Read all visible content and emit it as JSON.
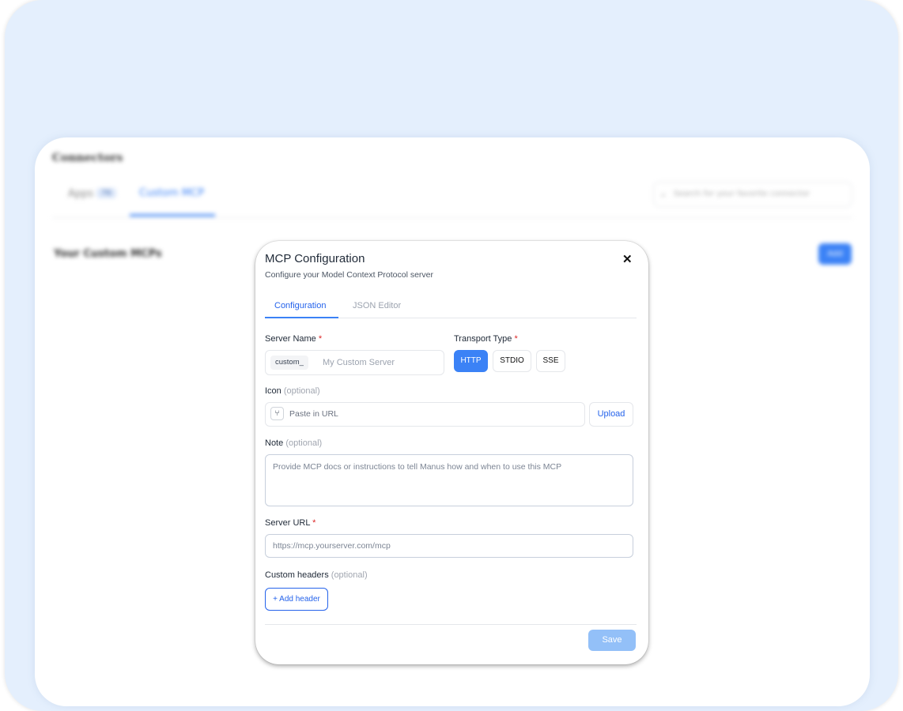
{
  "background": {
    "title": "Connectors",
    "tabs": [
      {
        "label": "Apps",
        "count": "76"
      },
      {
        "label": "Custom MCP"
      }
    ],
    "search_placeholder": "Search for your favorite connector",
    "section_title": "Your Custom MCPs",
    "add_button": "Add"
  },
  "modal": {
    "title": "MCP Configuration",
    "subtitle": "Configure your Model Context Protocol server",
    "close_icon": "close-icon",
    "tabs": [
      {
        "label": "Configuration",
        "active": true
      },
      {
        "label": "JSON Editor",
        "active": false
      }
    ],
    "server_name": {
      "label": "Server Name",
      "required": "*",
      "prefix": "custom_",
      "placeholder": "My Custom Server"
    },
    "transport": {
      "label": "Transport Type",
      "required": "*",
      "options": [
        "HTTP",
        "STDIO",
        "SSE"
      ],
      "selected": "HTTP"
    },
    "icon": {
      "label": "Icon",
      "optional": "(optional)",
      "glyph": "git-branch-icon",
      "placeholder": "Paste in URL",
      "upload": "Upload"
    },
    "note": {
      "label": "Note",
      "optional": "(optional)",
      "placeholder": "Provide MCP docs or instructions to tell Manus how and when to use this MCP"
    },
    "server_url": {
      "label": "Server URL",
      "required": "*",
      "placeholder": "https://mcp.yourserver.com/mcp"
    },
    "custom_headers": {
      "label": "Custom headers",
      "optional": "(optional)",
      "add": "+ Add header"
    },
    "save": "Save"
  },
  "colors": {
    "accent": "#3b82f6",
    "outer_bg": "#e4effd",
    "save_disabled": "#93c0f8"
  }
}
